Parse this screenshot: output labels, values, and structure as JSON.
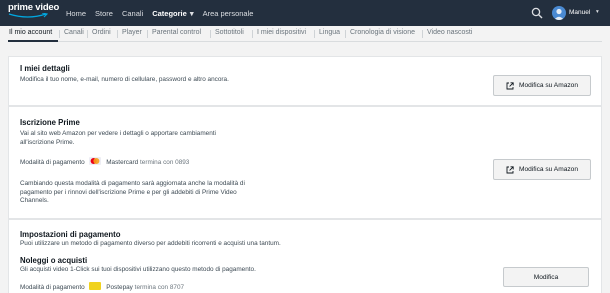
{
  "header": {
    "logo_text": "prime video",
    "nav": [
      {
        "label": "Home"
      },
      {
        "label": "Store"
      },
      {
        "label": "Canali"
      },
      {
        "label": "Categorie"
      },
      {
        "label": "Area personale"
      }
    ],
    "user_name": "Manuel"
  },
  "tabs": [
    {
      "label": "Il mio account"
    },
    {
      "label": "Canali"
    },
    {
      "label": "Ordini"
    },
    {
      "label": "Player"
    },
    {
      "label": "Parental control"
    },
    {
      "label": "Sottotitoli"
    },
    {
      "label": "I miei dispositivi"
    },
    {
      "label": "Lingua"
    },
    {
      "label": "Cronologia di visione"
    },
    {
      "label": "Video nascosti"
    }
  ],
  "dettagli": {
    "title": "I miei dettagli",
    "text": "Modifica il tuo nome, e-mail, numero di cellulare, password e altro ancora.",
    "button": "Modifica su Amazon"
  },
  "prime": {
    "title": "Iscrizione Prime",
    "text": "Vai al sito web Amazon per vedere i dettagli o apportare cambiamenti all'iscrizione Prime.",
    "payment_label": "Modalità di pagamento",
    "card_name": "Mastercard",
    "card_ending": "termina con 0893",
    "note": "Cambiando questa modalità di pagamento sarà aggiornata anche la modalità di pagamento per i rinnovi dell'iscrizione Prime e per gli addebiti di Prime Video Channels.",
    "button": "Modifica su Amazon"
  },
  "pagamento": {
    "title": "Impostazioni di pagamento",
    "text": "Puoi utilizzare un metodo di pagamento diverso per addebiti ricorrenti e acquisti una tantum.",
    "sub_title": "Noleggi o acquisti",
    "sub_text": "Gli acquisti video 1-Click sui tuoi dispositivi utilizzano questo metodo di pagamento.",
    "payment_label": "Modalità di pagamento",
    "card_name": "Postepay",
    "card_ending": "termina con 8707",
    "button": "Modifica"
  },
  "colors": {
    "header_bg": "#232f3e",
    "page_bg": "#f3f3f3",
    "prime_blue": "#00a8e1"
  }
}
